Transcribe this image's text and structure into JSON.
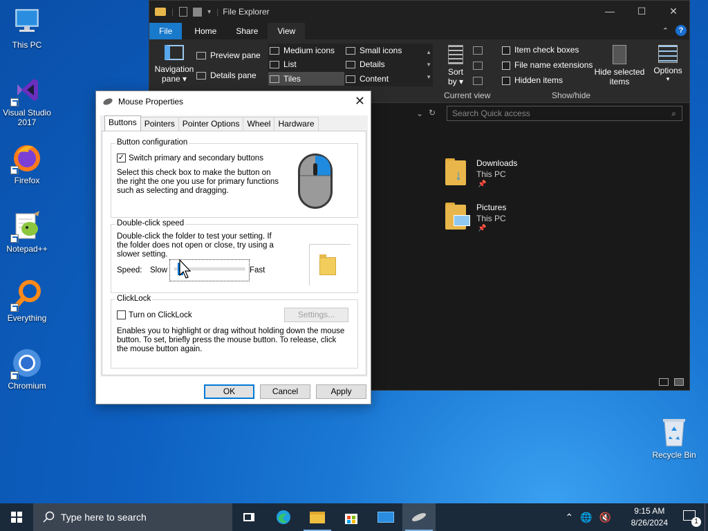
{
  "desktop": {
    "icons": [
      {
        "label": "This PC"
      },
      {
        "label": "Visual Studio 2017"
      },
      {
        "label": "Firefox"
      },
      {
        "label": "Notepad++"
      },
      {
        "label": "Everything"
      },
      {
        "label": "Chromium"
      },
      {
        "label": "Recycle Bin"
      }
    ]
  },
  "explorer": {
    "title": "File Explorer",
    "tabs": [
      "File",
      "Home",
      "Share",
      "View"
    ],
    "active_tab": "View",
    "panes": {
      "navigation_pane": "Navigation pane",
      "navigation_pane_l1": "Navigation",
      "navigation_pane_l2": "pane",
      "preview_pane": "Preview pane",
      "details_pane": "Details pane"
    },
    "layout": {
      "medium_icons": "Medium icons",
      "small_icons": "Small icons",
      "list": "List",
      "details": "Details",
      "tiles": "Tiles",
      "content": "Content"
    },
    "current_view": {
      "sort_l1": "Sort",
      "sort_l2": "by",
      "group_label": "Current view"
    },
    "show_hide": {
      "item_check_boxes": "Item check boxes",
      "file_name_extensions": "File name extensions",
      "hidden_items": "Hidden items",
      "hide_selected_l1": "Hide selected",
      "hide_selected_l2": "items",
      "group_label": "Show/hide"
    },
    "options": "Options",
    "search_placeholder": "Search Quick access",
    "items": [
      {
        "name": "Downloads",
        "location": "This PC",
        "pinned": "📌"
      },
      {
        "name": "Pictures",
        "location": "This PC",
        "pinned": "📌"
      }
    ]
  },
  "dialog": {
    "title": "Mouse Properties",
    "tabs": [
      "Buttons",
      "Pointers",
      "Pointer Options",
      "Wheel",
      "Hardware"
    ],
    "active_tab": "Buttons",
    "button_config": {
      "group_title": "Button configuration",
      "checkbox_label": "Switch primary and secondary buttons",
      "checked": true,
      "description": "Select this check box to make the button on the right the one you use for primary functions such as selecting and dragging."
    },
    "double_click": {
      "group_title": "Double-click speed",
      "description": "Double-click the folder to test your setting. If the folder does not open or close, try using a slower setting.",
      "speed_label": "Speed:",
      "slow_label": "Slow",
      "fast_label": "Fast",
      "speed_value": 0.05
    },
    "clicklock": {
      "group_title": "ClickLock",
      "checkbox_label": "Turn on ClickLock",
      "checked": false,
      "settings_button": "Settings...",
      "description": "Enables you to highlight or drag without holding down the mouse button. To set, briefly press the mouse button. To release, click the mouse button again."
    },
    "buttons": {
      "ok": "OK",
      "cancel": "Cancel",
      "apply": "Apply"
    }
  },
  "taskbar": {
    "search_placeholder": "Type here to search",
    "time": "9:15 AM",
    "date": "8/26/2024",
    "notification_count": "1"
  },
  "colors": {
    "accent": "#0078d7",
    "explorer_bg": "#191919",
    "ribbon_file_tab": "#1979ca"
  }
}
